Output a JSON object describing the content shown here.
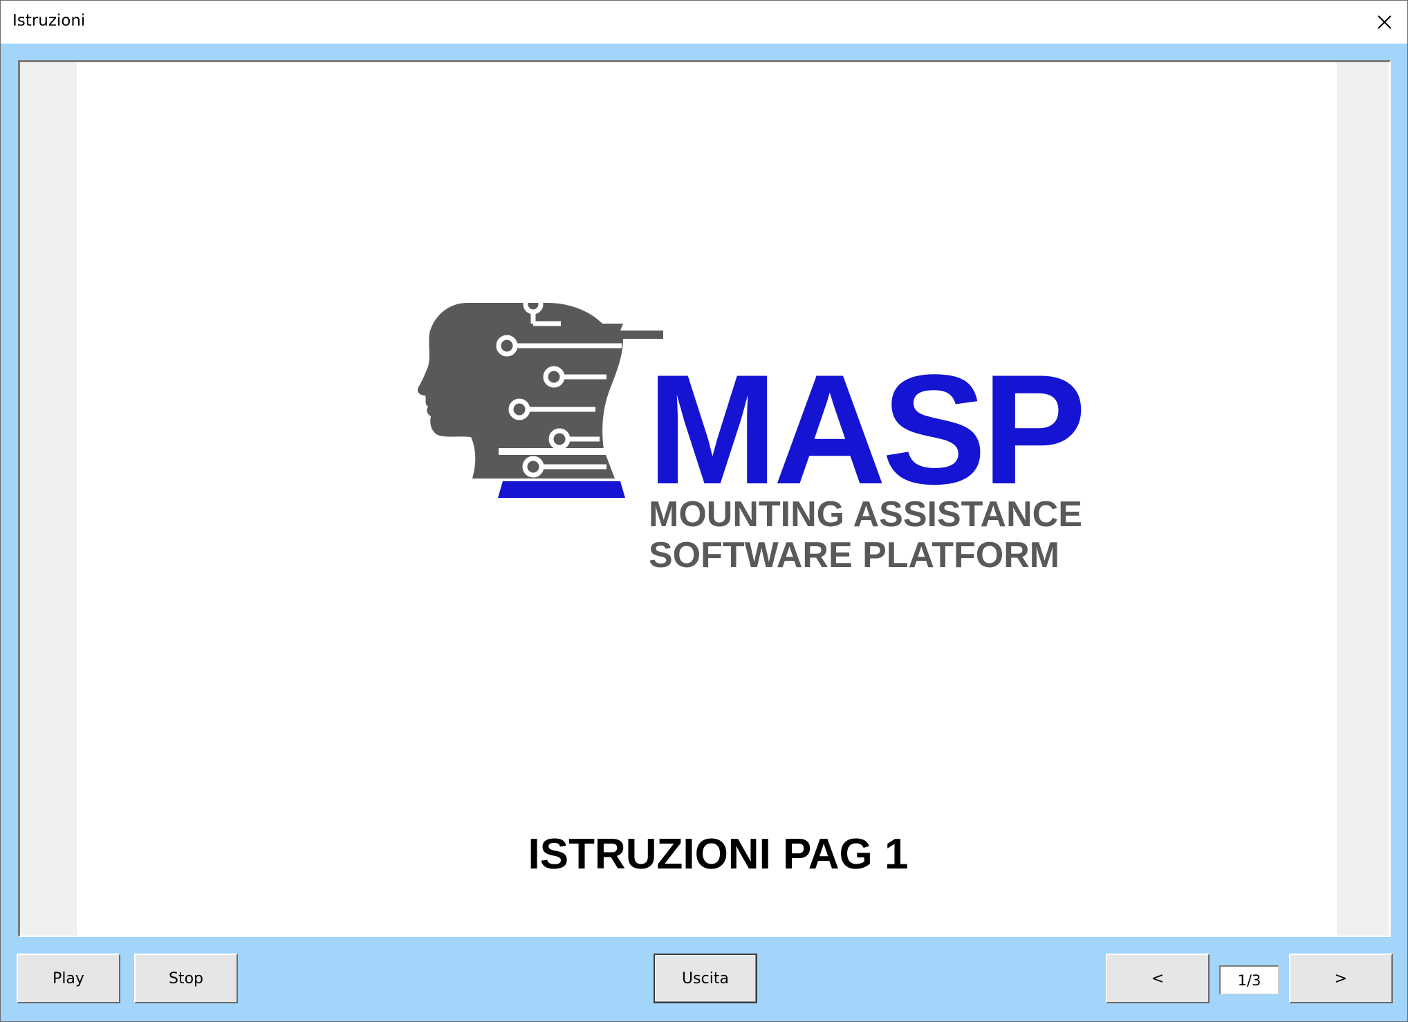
{
  "window": {
    "title": "Istruzioni",
    "close_icon": "close-icon"
  },
  "logo": {
    "word": "MASP",
    "line1": "MOUNTING ASSISTANCE",
    "line2": "SOFTWARE PLATFORM",
    "brand_color": "#1414d2",
    "gray_color": "#595959",
    "icon": "circuit-head-icon"
  },
  "page": {
    "heading": "ISTRUZIONI PAG 1"
  },
  "controls": {
    "play_label": "Play",
    "stop_label": "Stop",
    "exit_label": "Uscita",
    "prev_label": "<",
    "next_label": ">",
    "page_indicator": "1/3"
  },
  "colors": {
    "client_background": "#a3d5fb",
    "viewer_background": "#f0f0f0",
    "button_face": "#e6e6e6"
  }
}
